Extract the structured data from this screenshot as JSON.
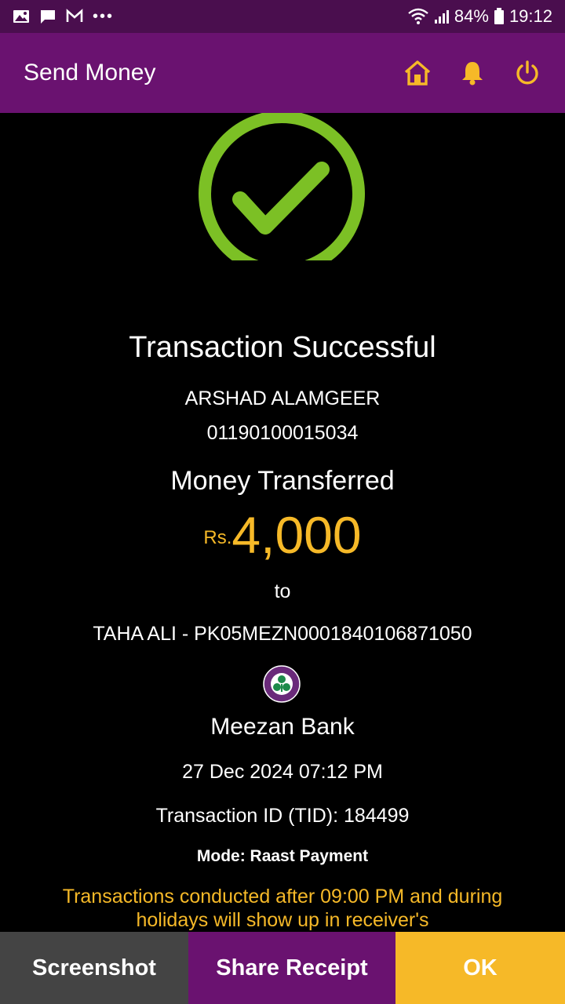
{
  "status_bar": {
    "battery": "84%",
    "time": "19:12",
    "dots": "•••",
    "icons": [
      "gallery-icon",
      "message-icon",
      "gmail-icon",
      "wifi-icon",
      "signal-icon",
      "battery-icon"
    ]
  },
  "header": {
    "title": "Send Money",
    "actions": [
      "home-icon",
      "bell-icon",
      "power-icon"
    ],
    "accent": "#f6b928",
    "background": "#6a1270"
  },
  "receipt": {
    "status_icon": "check-circle-icon",
    "status_color": "#7cc025",
    "title": "Transaction Successful",
    "sender_name": "ARSHAD ALAMGEER",
    "sender_account": "01190100015034",
    "label": "Money Transferred",
    "currency": "Rs.",
    "amount": "4,000",
    "to_label": "to",
    "recipient": "TAHA ALI - PK05MEZN0001840106871050",
    "bank_logo": "meezan-bank-logo",
    "bank_name": "Meezan Bank",
    "datetime": "27 Dec 2024 07:12 PM",
    "tid": "Transaction ID (TID): 184499",
    "mode": "Mode: Raast Payment",
    "notice": "Transactions conducted after 09:00 PM and during holidays will show up in receiver's"
  },
  "buttons": {
    "screenshot": "Screenshot",
    "share": "Share Receipt",
    "ok": "OK"
  }
}
